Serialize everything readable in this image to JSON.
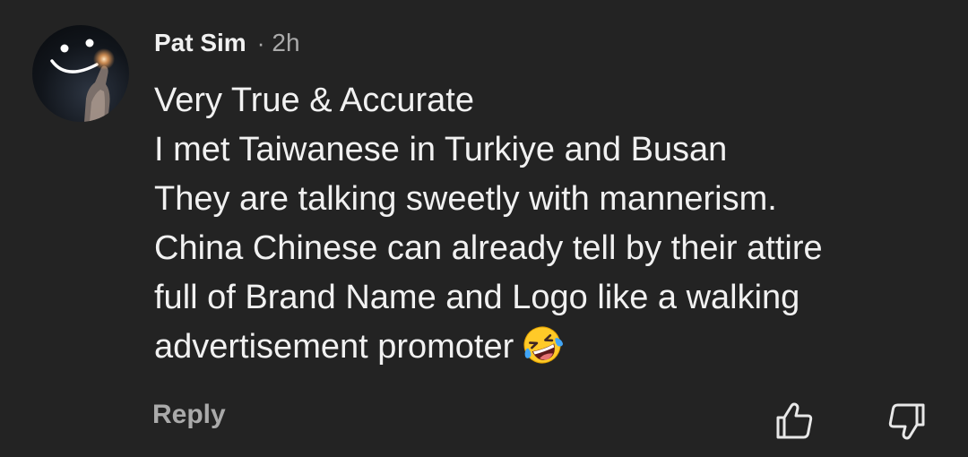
{
  "comment": {
    "author": "Pat Sim",
    "separator": "·",
    "time": "2h",
    "lines": [
      "Very True & Accurate",
      "I met Taiwanese in Turkiye and Busan",
      "They are talking sweetly with mannerism.",
      "China Chinese can already tell by their attire",
      "full of Brand Name and Logo like a walking",
      "advertisement promoter"
    ],
    "emoji": "rolling-on-floor-laughing-emoji"
  },
  "actions": {
    "reply_label": "Reply",
    "like_icon": "thumbs-up-icon",
    "dislike_icon": "thumbs-down-icon"
  }
}
